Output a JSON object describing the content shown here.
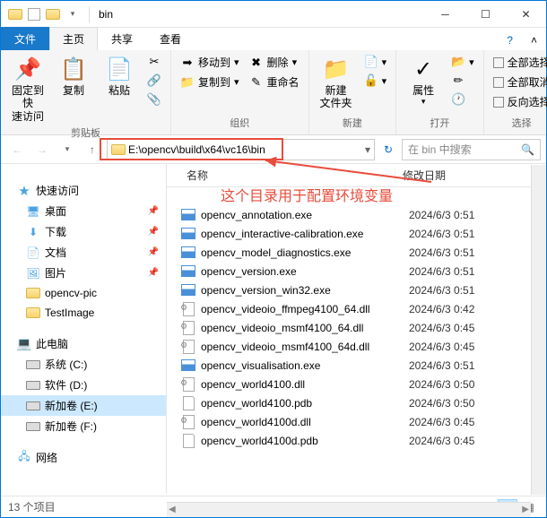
{
  "titlebar": {
    "title": "bin"
  },
  "tabs": {
    "file": "文件",
    "home": "主页",
    "share": "共享",
    "view": "查看"
  },
  "ribbon": {
    "pin": "固定到快\n速访问",
    "copy": "复制",
    "paste": "粘贴",
    "moveto": "移动到",
    "copyto": "复制到",
    "delete": "删除",
    "rename": "重命名",
    "newfolder": "新建\n文件夹",
    "properties": "属性",
    "selectall": "全部选择",
    "selectnone": "全部取消",
    "selectinv": "反向选择",
    "g_clipboard": "剪贴板",
    "g_organize": "组织",
    "g_new": "新建",
    "g_open": "打开",
    "g_select": "选择"
  },
  "nav": {
    "path": "E:\\opencv\\build\\x64\\vc16\\bin",
    "search_placeholder": "在 bin 中搜索"
  },
  "columns": {
    "name": "名称",
    "date": "修改日期"
  },
  "sidebar": {
    "quick": "快速访问",
    "desktop": "桌面",
    "downloads": "下载",
    "documents": "文档",
    "pictures": "图片",
    "f1": "opencv-pic",
    "f2": "TestImage",
    "thispc": "此电脑",
    "c": "系统 (C:)",
    "d": "软件 (D:)",
    "e": "新加卷 (E:)",
    "f": "新加卷 (F:)",
    "network": "网络"
  },
  "annotation": "这个目录用于配置环境变量",
  "files": [
    {
      "name": "opencv_annotation.exe",
      "date": "2024/6/3 0:51",
      "type": "exe"
    },
    {
      "name": "opencv_interactive-calibration.exe",
      "date": "2024/6/3 0:51",
      "type": "exe"
    },
    {
      "name": "opencv_model_diagnostics.exe",
      "date": "2024/6/3 0:51",
      "type": "exe"
    },
    {
      "name": "opencv_version.exe",
      "date": "2024/6/3 0:51",
      "type": "exe"
    },
    {
      "name": "opencv_version_win32.exe",
      "date": "2024/6/3 0:51",
      "type": "exe"
    },
    {
      "name": "opencv_videoio_ffmpeg4100_64.dll",
      "date": "2024/6/3 0:42",
      "type": "dll"
    },
    {
      "name": "opencv_videoio_msmf4100_64.dll",
      "date": "2024/6/3 0:45",
      "type": "dll"
    },
    {
      "name": "opencv_videoio_msmf4100_64d.dll",
      "date": "2024/6/3 0:45",
      "type": "dll"
    },
    {
      "name": "opencv_visualisation.exe",
      "date": "2024/6/3 0:51",
      "type": "exe"
    },
    {
      "name": "opencv_world4100.dll",
      "date": "2024/6/3 0:50",
      "type": "dll"
    },
    {
      "name": "opencv_world4100.pdb",
      "date": "2024/6/3 0:50",
      "type": "pdb"
    },
    {
      "name": "opencv_world4100d.dll",
      "date": "2024/6/3 0:45",
      "type": "dll"
    },
    {
      "name": "opencv_world4100d.pdb",
      "date": "2024/6/3 0:45",
      "type": "pdb"
    }
  ],
  "status": {
    "count": "13 个项目"
  }
}
